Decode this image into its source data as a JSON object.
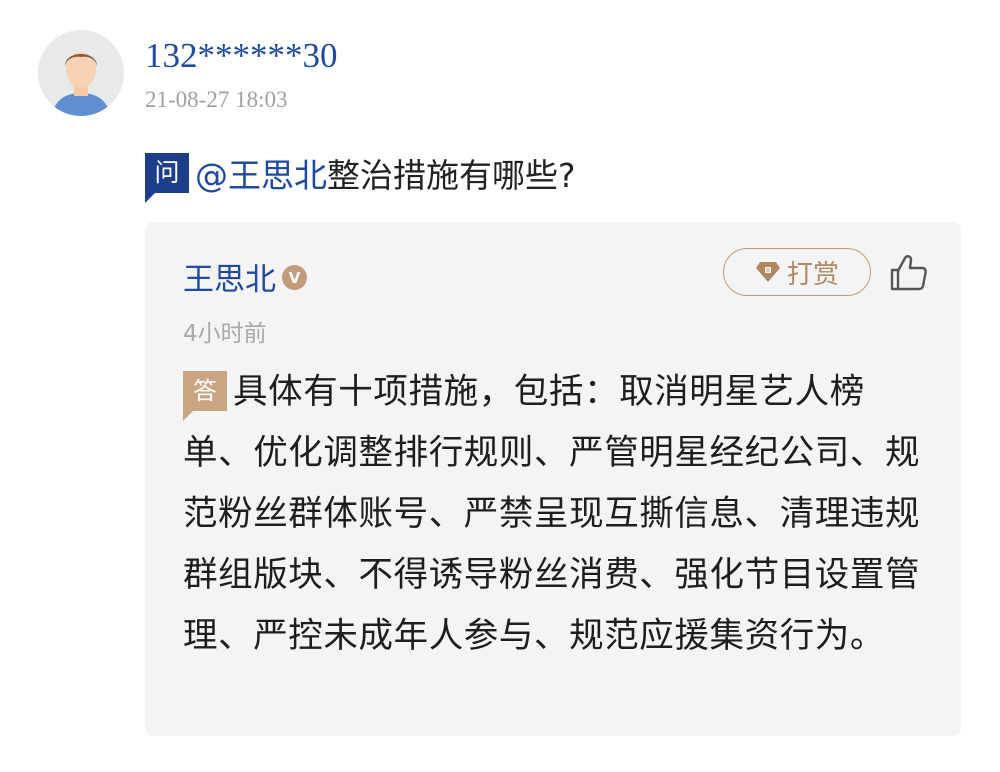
{
  "question_post": {
    "username": "132******30",
    "timestamp": "21-08-27 18:03",
    "badge": "问",
    "mention": "@王思北",
    "text": "整治措施有哪些?"
  },
  "answer": {
    "answerer": "王思北",
    "verified_badge": "V",
    "time": "4小时前",
    "tip_label": "打赏",
    "badge": "答",
    "text": "具体有十项措施，包括：取消明星艺人榜单、优化调整排行规则、严管明星经纪公司、规范粉丝群体账号、严禁呈现互撕信息、清理违规群组版块、不得诱导粉丝消费、强化节目设置管理、严控未成年人参与、规范应援集资行为。"
  },
  "icons": {
    "avatar": "default-user-avatar",
    "verified": "verified-v-badge-icon",
    "tip": "diamond-icon",
    "like": "thumbs-up-icon"
  },
  "colors": {
    "link_blue": "#1f4aa0",
    "question_badge": "#1d3e8a",
    "answer_badge": "#c9a582",
    "tip_accent": "#b08863",
    "card_bg": "#f4f4f4"
  }
}
